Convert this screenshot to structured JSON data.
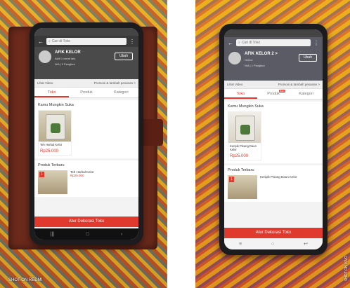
{
  "left": {
    "search_placeholder": "Cari di Toko",
    "store_name": "AFIK KELOR",
    "store_status": "Aktif 1 menit lalu",
    "store_rating": "N/A | 0 Pengikut",
    "edit_label": "Ubah",
    "video_label": "Lihat Video",
    "promo_label": "Promosi & tambah pesanan >",
    "tabs": [
      "Toko",
      "Produk",
      "Kategori"
    ],
    "section_recommend": "Kamu Mungkin Suka",
    "product_name": "Teh Herbal Kelor",
    "product_price": "Rp25.000",
    "section_favorite": "Produk Terbaru",
    "favorite_name": "Teh Herbal Kelor",
    "favorite_price": "Rp25.000",
    "cta_label": "Atur Dekorasi Toko",
    "watermark": "SHOT ON REDMI"
  },
  "right": {
    "search_placeholder": "Cari di Toko",
    "store_name": "AFIK KELOR 2 >",
    "store_status": "Online",
    "store_rating": "N/A | 1 Pengikut",
    "edit_label": "Ubah",
    "video_label": "Lihat Video",
    "promo_label": "Promosi & tambah pesanan >",
    "tabs": [
      "Toko",
      "Produk",
      "Kategori"
    ],
    "tab_badge": "Baru",
    "section_recommend": "Kamu Mungkin Suka",
    "product_name": "Keripik Pisang Daun Kelor",
    "product_price": "Rp25.000",
    "section_favorite": "Produk Terbaru",
    "favorite_name": "Keripik Pisang Daun Kelor",
    "cta_label": "Atur Dekorasi Toko",
    "watermark": "SHOT ON VIVO"
  }
}
